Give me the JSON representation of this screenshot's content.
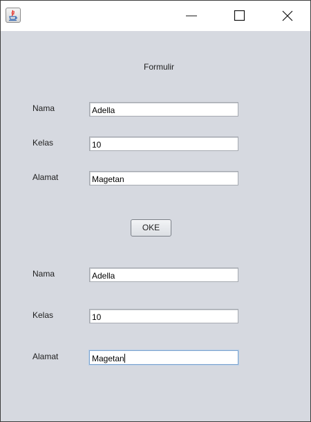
{
  "window": {
    "app_icon": "java-cup-icon",
    "controls": {
      "minimize": "minimize-icon",
      "maximize": "maximize-icon",
      "close": "close-icon"
    }
  },
  "form": {
    "heading": "Formulir",
    "input_section": {
      "nama_label": "Nama",
      "nama_value": "Adella",
      "kelas_label": "Kelas",
      "kelas_value": "10",
      "alamat_label": "Alamat",
      "alamat_value": "Magetan"
    },
    "submit_label": "OKE",
    "output_section": {
      "nama_label": "Nama",
      "nama_value": "Adella",
      "kelas_label": "Kelas",
      "kelas_value": "10",
      "alamat_label": "Alamat",
      "alamat_value": "Magetan"
    }
  },
  "colors": {
    "window_background": "#d6d9e0",
    "titlebar": "#ffffff",
    "field_background": "#ffffff",
    "focus_border": "#7ea4cf"
  }
}
